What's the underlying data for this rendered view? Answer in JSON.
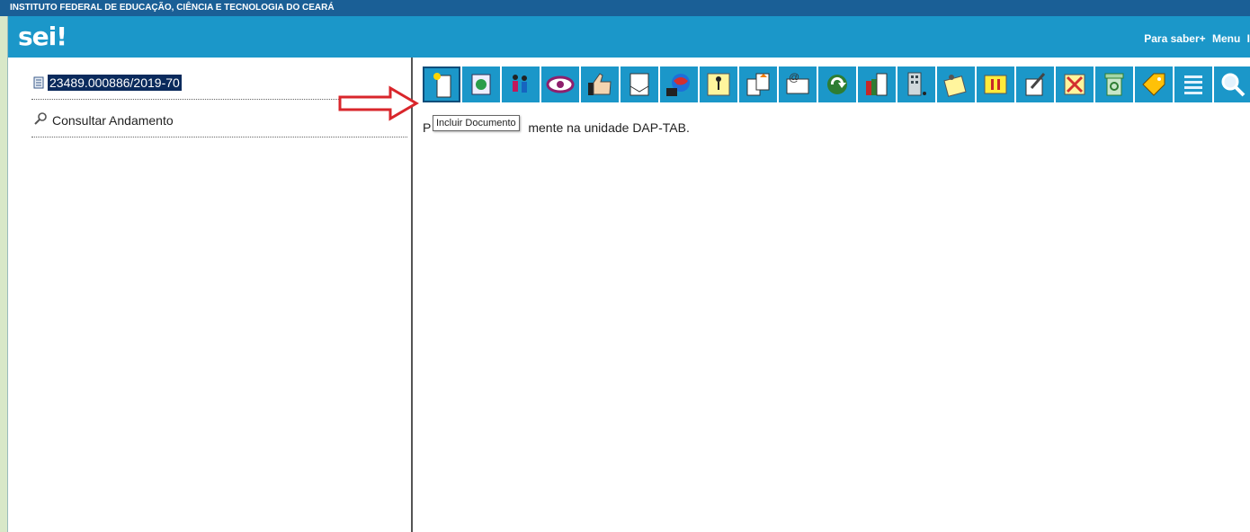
{
  "institution": "INSTITUTO FEDERAL DE EDUCAÇÃO, CIÊNCIA E TECNOLOGIA DO CEARÁ",
  "logo": "sei!",
  "header": {
    "links": [
      "Para saber+",
      "Menu",
      "I"
    ]
  },
  "tree": {
    "process_number": "23489.000886/2019-70",
    "consult_label": "Consultar Andamento"
  },
  "toolbar": {
    "tooltip": "Incluir Documento",
    "buttons": [
      {
        "icon": "new-document-icon"
      },
      {
        "icon": "start-related-process-icon"
      },
      {
        "icon": "send-process-icon"
      },
      {
        "icon": "view-eye-icon"
      },
      {
        "icon": "thumbs-up-icon"
      },
      {
        "icon": "email-document-icon"
      },
      {
        "icon": "world-globe-icon"
      },
      {
        "icon": "interested-person-icon"
      },
      {
        "icon": "copy-documents-icon"
      },
      {
        "icon": "send-email-icon"
      },
      {
        "icon": "refresh-arrow-icon"
      },
      {
        "icon": "books-icon"
      },
      {
        "icon": "building-icon"
      },
      {
        "icon": "note-pin-icon"
      },
      {
        "icon": "pause-icon"
      },
      {
        "icon": "edit-pen-icon"
      },
      {
        "icon": "cancel-document-icon"
      },
      {
        "icon": "recycle-bin-icon"
      },
      {
        "icon": "tag-icon"
      },
      {
        "icon": "list-icon"
      },
      {
        "icon": "search-icon"
      }
    ]
  },
  "status_message": {
    "prefix": "P",
    "suffix": "mente na unidade DAP-TAB."
  },
  "colors": {
    "header": "#1b97c9",
    "topbar": "#1a5f96",
    "arrow": "#d9262b"
  }
}
